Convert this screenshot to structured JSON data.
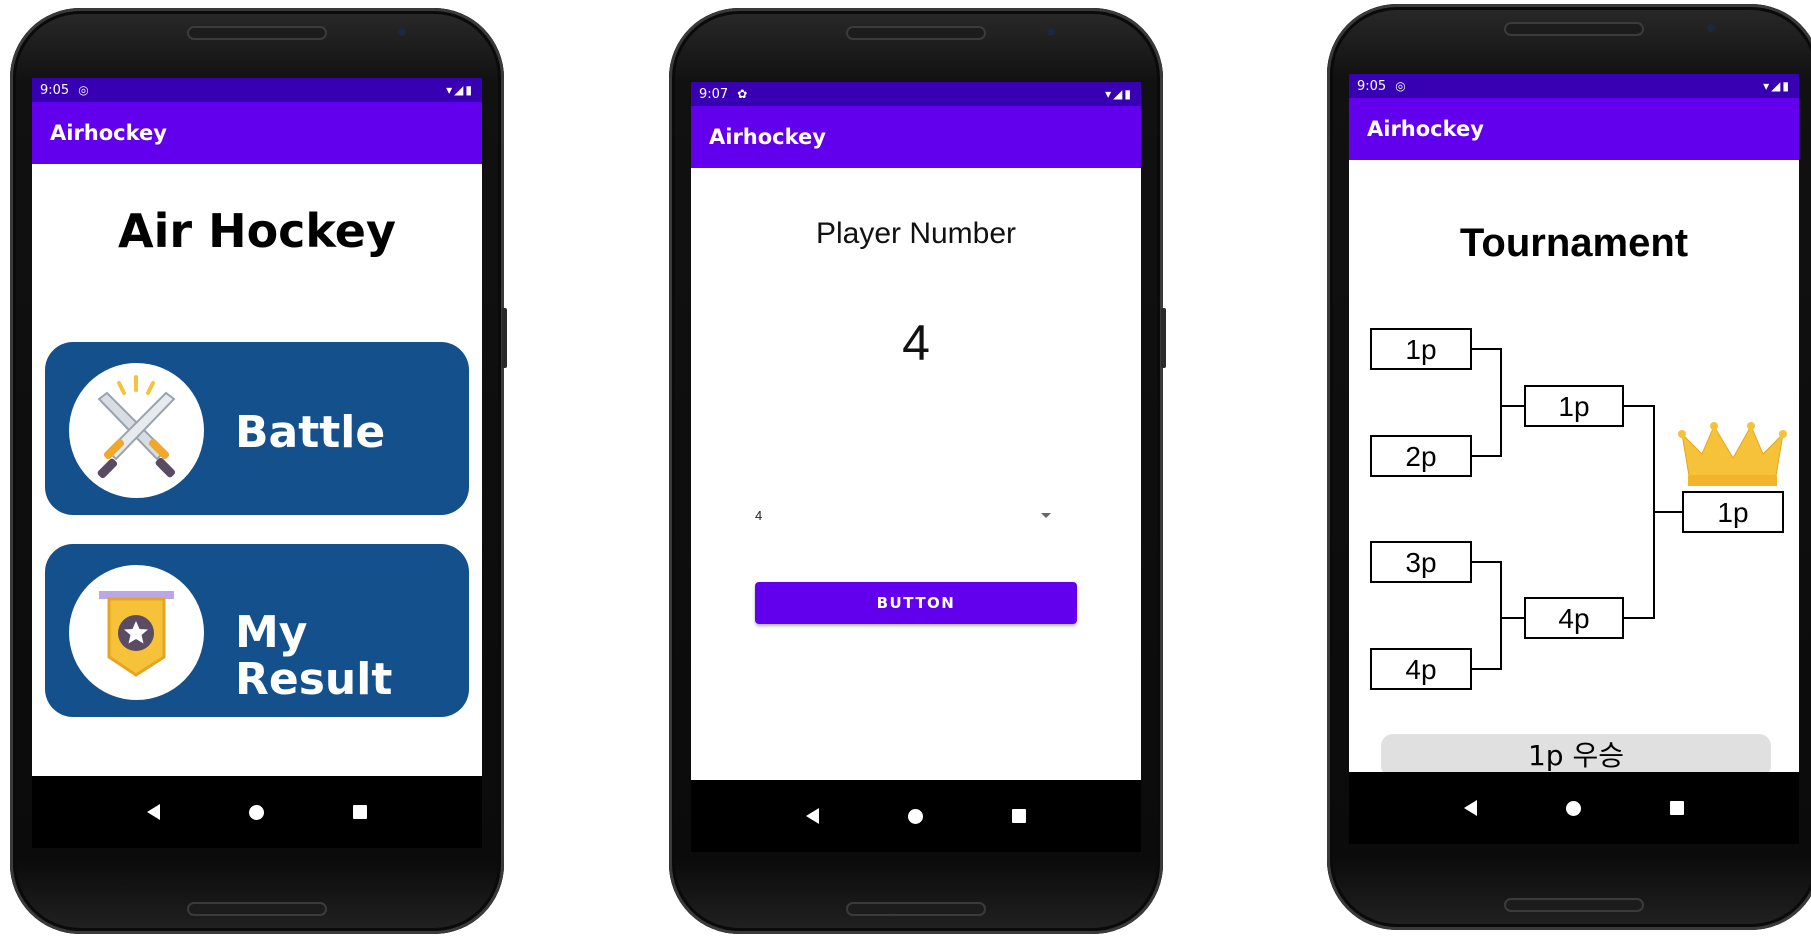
{
  "screens": [
    {
      "status_time": "9:05",
      "app_title": "Airhockey",
      "heading": "Air Hockey",
      "menu": [
        {
          "label": "Battle",
          "icon": "crossed-swords-icon"
        },
        {
          "label": "My Result",
          "line1": "My",
          "line2": "Result",
          "icon": "medal-badge-icon"
        }
      ]
    },
    {
      "status_time": "9:07",
      "app_title": "Airhockey",
      "heading": "Player Number",
      "number": "4",
      "spinner_value": "4",
      "button_label": "BUTTON"
    },
    {
      "status_time": "9:05",
      "app_title": "Airhockey",
      "heading": "Tournament",
      "round1": [
        "1p",
        "2p",
        "3p",
        "4p"
      ],
      "round2": [
        "1p",
        "4p"
      ],
      "winner": "1p",
      "result_text": "1p 우승"
    }
  ],
  "colors": {
    "status_bar": "#3700b3",
    "app_bar": "#6200ee",
    "menu_card": "#14508c",
    "button": "#6200ee",
    "crown": "#f5c23a"
  }
}
